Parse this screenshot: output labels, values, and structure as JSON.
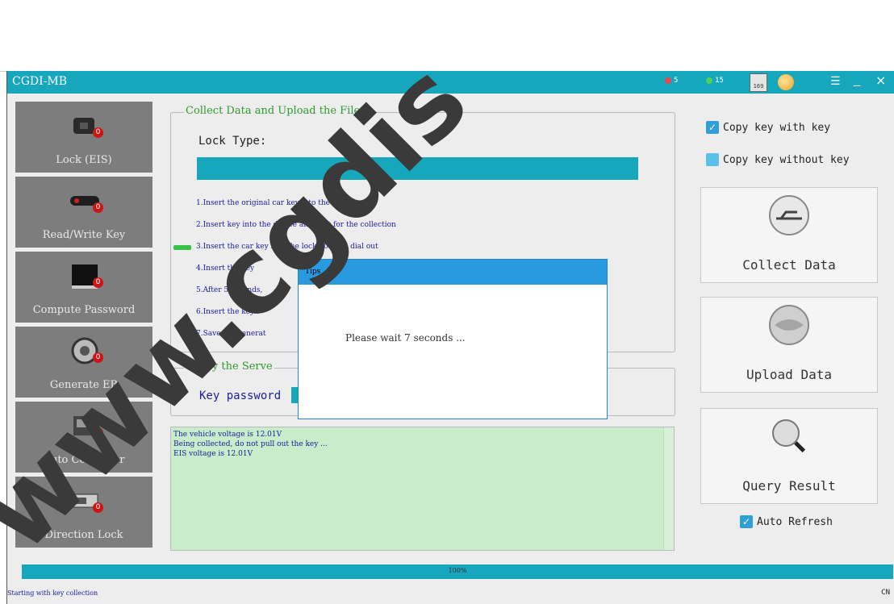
{
  "window": {
    "title": "CGDI-MB"
  },
  "titlebar": {
    "stat_red": "5",
    "stat_green": "15",
    "calendar": "169",
    "menu_icon": "menu-icon",
    "minimize_label": "_",
    "close_label": "×"
  },
  "sidebar": {
    "items": [
      {
        "label": "Lock (EIS)",
        "icon": "ignition-lock-icon",
        "badge": "0"
      },
      {
        "label": "Read/Write Key",
        "icon": "car-key-icon",
        "badge": "0"
      },
      {
        "label": "Compute Password",
        "icon": "display-icon",
        "badge": "0"
      },
      {
        "label": "Generate EB",
        "icon": "steering-wheel-icon",
        "badge": "0"
      },
      {
        "label": "Auto Computer",
        "icon": "ecu-icon",
        "badge": "0"
      },
      {
        "label": "Direction Lock",
        "icon": "steering-lock-icon",
        "badge": "0"
      }
    ]
  },
  "collect": {
    "legend": "Collect Data and Upload the File",
    "lock_type_label": "Lock Type:",
    "steps": [
      "1.Insert the original car key into the lock",
      "2.Insert key into the device and wait for the collection",
      "3.Insert the car key into the lock 10s and dial out",
      "4.Insert the key",
      "5.After 5 seconds,",
      "6.Insert the key",
      "7.Save the generat"
    ]
  },
  "query": {
    "legend": "Query the Serve",
    "key_password_label": "Key password"
  },
  "log": {
    "lines": [
      "The vehicle voltage is 12.01V",
      "Being collected, do not pull out the key ...",
      "EIS voltage is 12.01V"
    ]
  },
  "options": {
    "copy_with_key": "Copy key with key",
    "copy_without_key": "Copy key without key",
    "auto_refresh": "Auto Refresh"
  },
  "buttons": {
    "collect_data": "Collect Data",
    "upload_data": "Upload  Data",
    "query_result": "Query Result"
  },
  "progress": {
    "text": "100%",
    "fraction": 1.0
  },
  "status": {
    "text": "Starting with key collection",
    "lang": "CN"
  },
  "dialog": {
    "title": "Tips",
    "message": "Please wait 7 seconds ..."
  },
  "watermark": {
    "text": "www.cgdis"
  },
  "colors": {
    "accent": "#17a7bd",
    "sidebar": "#7d7d7d",
    "log_bg": "#c9ecca",
    "dialog_title": "#2a9ae0",
    "badge": "#cc1616"
  }
}
